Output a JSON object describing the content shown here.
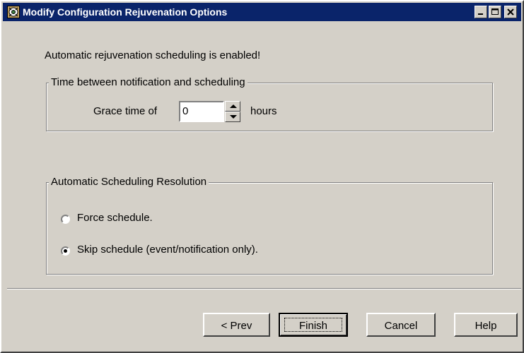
{
  "window": {
    "title": "Modify Configuration Rejuvenation Options"
  },
  "message": "Automatic rejuvenation scheduling is enabled!",
  "grace_group": {
    "title": "Time between notification and scheduling",
    "prefix_label": "Grace time of",
    "value": "0",
    "unit_label": "hours"
  },
  "resolution_group": {
    "title": "Automatic Scheduling Resolution",
    "options": [
      {
        "label": "Force schedule.",
        "selected": false
      },
      {
        "label": "Skip schedule (event/notification only).",
        "selected": true
      }
    ]
  },
  "buttons": {
    "prev": "< Prev",
    "finish": "Finish",
    "cancel": "Cancel",
    "help": "Help"
  }
}
